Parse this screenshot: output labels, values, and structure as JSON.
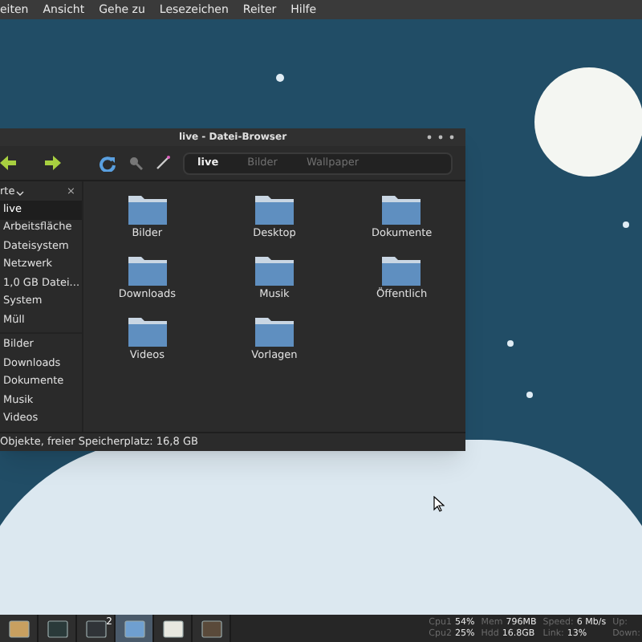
{
  "menu_bar": {
    "items": [
      "eiten",
      "Ansicht",
      "Gehe zu",
      "Lesezeichen",
      "Reiter",
      "Hilfe"
    ]
  },
  "window": {
    "title": "live - Datei-Browser",
    "breadcrumbs": [
      {
        "label": "live",
        "selected": true
      },
      {
        "label": "Bilder",
        "selected": false
      },
      {
        "label": "Wallpaper",
        "selected": false
      }
    ],
    "sidebar": {
      "header": "rte",
      "close": "×",
      "places": [
        {
          "label": "live",
          "selected": true
        },
        {
          "label": "Arbeitsfläche",
          "selected": false
        },
        {
          "label": "Dateisystem",
          "selected": false
        },
        {
          "label": "Netzwerk",
          "selected": false
        },
        {
          "label": "1,0 GB Datei...",
          "selected": false
        },
        {
          "label": "System",
          "selected": false
        },
        {
          "label": "Müll",
          "selected": false
        }
      ],
      "bookmarks": [
        {
          "label": "Bilder",
          "selected": false
        },
        {
          "label": "Downloads",
          "selected": false
        },
        {
          "label": "Dokumente",
          "selected": false
        },
        {
          "label": "Musik",
          "selected": false
        },
        {
          "label": "Videos",
          "selected": false
        }
      ]
    },
    "files": [
      "Bilder",
      "Desktop",
      "Dokumente",
      "Downloads",
      "Musik",
      "Öffentlich",
      "Videos",
      "Vorlagen"
    ],
    "status_bar": "Objekte, freier Speicherplatz: 16,8 GB"
  },
  "taskbar": {
    "apps": [
      {
        "selected": false
      },
      {
        "selected": false
      },
      {
        "selected": false,
        "badge": "2"
      },
      {
        "selected": true
      },
      {
        "selected": false
      },
      {
        "selected": false
      }
    ],
    "stats": [
      [
        {
          "label": "Cpu1",
          "value": "54%"
        },
        {
          "label": "Cpu2",
          "value": "25%"
        }
      ],
      [
        {
          "label": "Mem",
          "value": "796MB"
        },
        {
          "label": "Hdd",
          "value": "16.8GB"
        }
      ],
      [
        {
          "label": "Speed:",
          "value": "6 Mb/s"
        },
        {
          "label": "Link:",
          "value": "13%"
        }
      ],
      [
        {
          "label": "Up:"
        },
        {
          "label": "Down:"
        }
      ]
    ]
  }
}
